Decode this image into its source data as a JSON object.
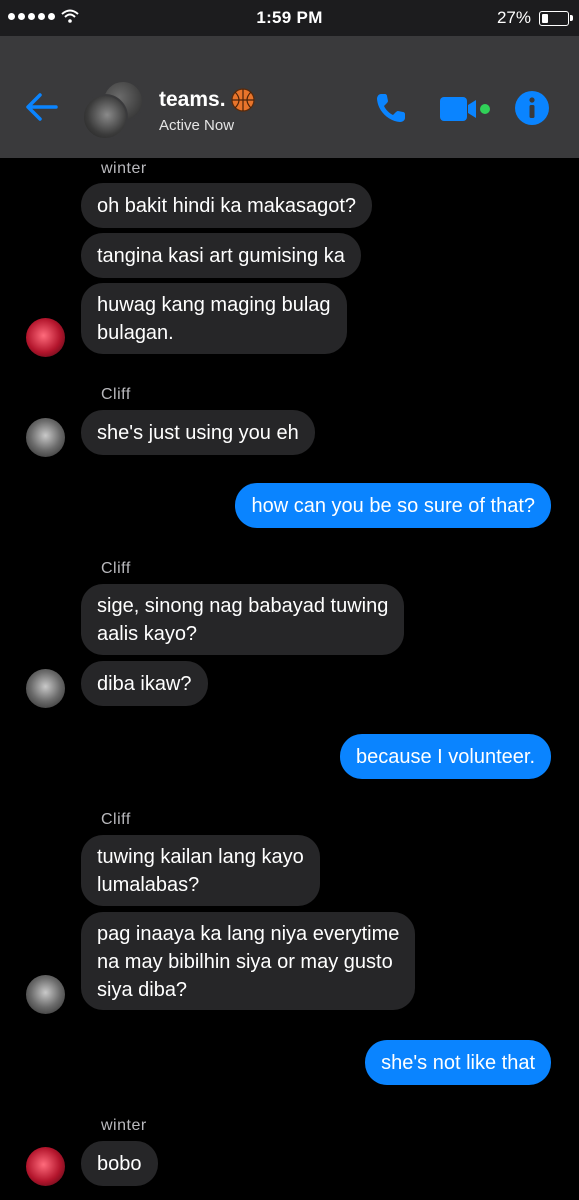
{
  "status": {
    "time": "1:59 PM",
    "battery": "27%",
    "battery_level": 0.27
  },
  "header": {
    "title": "teams.",
    "subtitle": "Active Now"
  },
  "messages": {
    "sender1": "winter",
    "m1": "oh bakit hindi ka makasagot?",
    "m2": "tangina kasi art gumising ka",
    "m3a": "huwag kang maging bulag",
    "m3b": "bulagan.",
    "sender2": "Cliff",
    "m4": "she's just using you eh",
    "m5": "how can you be so sure of that?",
    "sender3": "Cliff",
    "m6a": "sige, sinong nag babayad tuwing",
    "m6b": "aalis kayo?",
    "m7": "diba ikaw?",
    "m8": "because I volunteer.",
    "sender4": "Cliff",
    "m9a": "tuwing kailan lang kayo",
    "m9b": "lumalabas?",
    "m10a": "pag inaaya ka lang niya everytime",
    "m10b": "na may bibilhin siya or may gusto",
    "m10c": "siya diba?",
    "m11": "she's not like that",
    "sender5": "winter",
    "m12": "bobo"
  },
  "colors": {
    "accent": "#0a84ff",
    "incoming": "#262628",
    "header": "#3a3a3c",
    "online": "#30d158"
  },
  "icons": [
    "signal-dots",
    "wifi-icon",
    "battery-icon",
    "back-arrow-icon",
    "basketball-icon",
    "phone-icon",
    "video-icon",
    "info-icon"
  ]
}
